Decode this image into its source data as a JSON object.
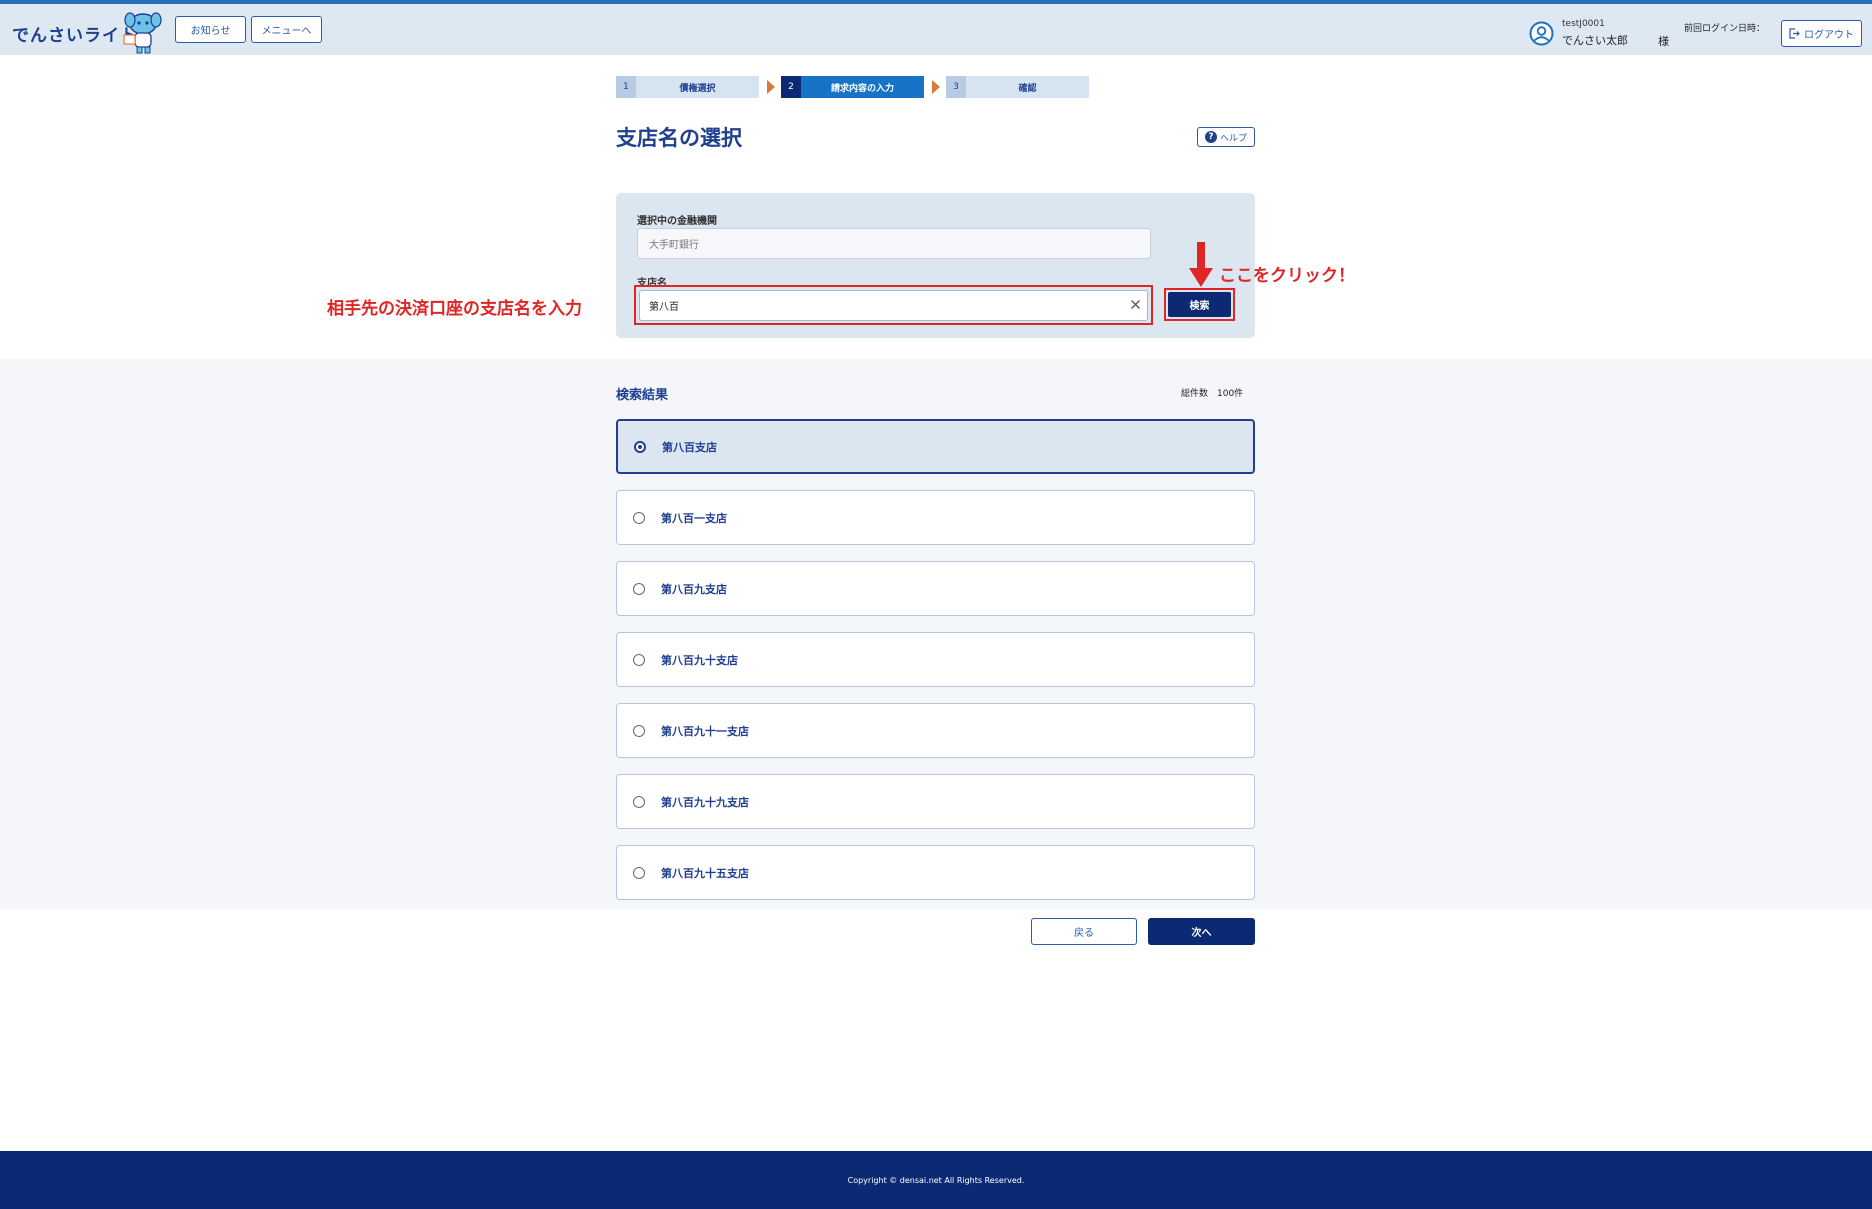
{
  "header": {
    "logo_text": "でんさいライト",
    "news_label": "お知らせ",
    "menu_label": "メニューへ",
    "user_id": "testJ0001",
    "user_name": "でんさい太郎",
    "honorific": "様",
    "last_login_label": "前回ログイン日時：",
    "logout_label": "ログアウト"
  },
  "steps": [
    {
      "num": "1",
      "label": "債権選択"
    },
    {
      "num": "2",
      "label": "請求内容の入力"
    },
    {
      "num": "3",
      "label": "確認"
    }
  ],
  "page": {
    "title": "支店名の選択",
    "help_label": "ヘルプ"
  },
  "search": {
    "bank_label": "選択中の金融機関",
    "bank_value": "大手町銀行",
    "branch_label": "支店名",
    "branch_value": "第八百",
    "search_button": "検索"
  },
  "annotations": {
    "left": "相手先の決済口座の支店名を入力",
    "right": "ここをクリック！"
  },
  "results": {
    "title": "検索結果",
    "total_label": "総件数　100件",
    "items": [
      {
        "label": "第八百支店",
        "selected": true
      },
      {
        "label": "第八百一支店",
        "selected": false
      },
      {
        "label": "第八百九支店",
        "selected": false
      },
      {
        "label": "第八百九十支店",
        "selected": false
      },
      {
        "label": "第八百九十一支店",
        "selected": false
      },
      {
        "label": "第八百九十九支店",
        "selected": false
      },
      {
        "label": "第八百九十五支店",
        "selected": false
      }
    ]
  },
  "actions": {
    "back_label": "戻る",
    "next_label": "次へ"
  },
  "footer": {
    "copyright": "Copyright © densai.net All Rights Reserved."
  },
  "colors": {
    "brand_navy": "#0b2a73",
    "accent_blue": "#1773c7",
    "annotation_red": "#e02525",
    "header_bg": "#dde8f3"
  }
}
